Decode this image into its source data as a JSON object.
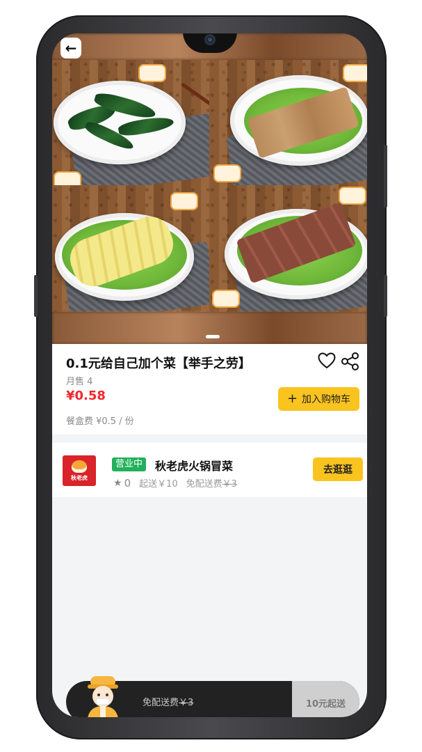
{
  "header": {
    "back_icon": "arrow-left-icon"
  },
  "gallery": {
    "pager_active": 1,
    "items": [
      "kelp-dish",
      "konjac-dish",
      "potato-dish",
      "tofu-skin-dish"
    ]
  },
  "product": {
    "title": "0.1元给自己加个菜【举手之劳】",
    "monthly_sales": "月售 4",
    "price": "¥0.58",
    "packaging_fee": "餐盒费 ¥0.5 / 份",
    "add_to_cart_label": "加入购物车",
    "favorite_icon": "heart-icon",
    "share_icon": "share-icon"
  },
  "store": {
    "status_badge": "营业中",
    "name": "秋老虎火锅冒菜",
    "logo_text": "秋老虎",
    "rating": "0",
    "min_order": "起送￥10",
    "free_delivery_label": "免配送费",
    "free_delivery_original": "￥3",
    "visit_label": "去逛逛"
  },
  "cart_bar": {
    "free_delivery_label": "免配送费",
    "free_delivery_original": "￥3",
    "min_order_label": "10元起送"
  },
  "colors": {
    "accent_yellow": "#f9c320",
    "price_red": "#f0282d",
    "open_green": "#22b05a",
    "cart_dark": "#222222"
  }
}
